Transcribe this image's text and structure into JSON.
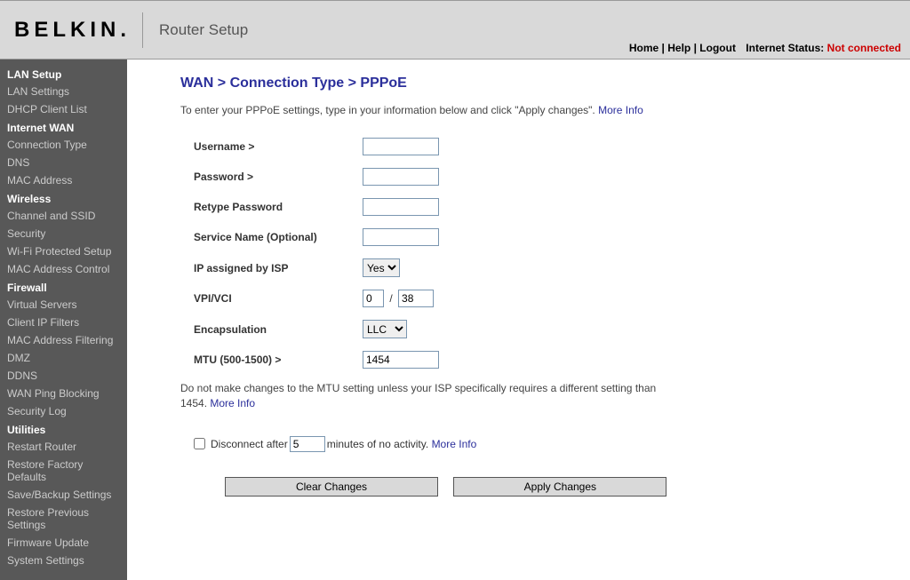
{
  "header": {
    "logo_text": "BELKIN",
    "title": "Router Setup",
    "links": {
      "home": "Home",
      "help": "Help",
      "logout": "Logout"
    },
    "internet_status_label": "Internet Status:",
    "internet_status_value": "Not connected"
  },
  "sidebar": {
    "s1": {
      "head": "LAN Setup",
      "i0": "LAN Settings",
      "i1": "DHCP Client List"
    },
    "s2": {
      "head": "Internet WAN",
      "i0": "Connection Type",
      "i1": "DNS",
      "i2": "MAC Address"
    },
    "s3": {
      "head": "Wireless",
      "i0": "Channel and SSID",
      "i1": "Security",
      "i2": "Wi-Fi Protected Setup",
      "i3": "MAC Address Control"
    },
    "s4": {
      "head": "Firewall",
      "i0": "Virtual Servers",
      "i1": "Client IP Filters",
      "i2": "MAC Address Filtering",
      "i3": "DMZ",
      "i4": "DDNS",
      "i5": "WAN Ping Blocking",
      "i6": "Security Log"
    },
    "s5": {
      "head": "Utilities",
      "i0": "Restart Router",
      "i1": "Restore Factory Defaults",
      "i2": "Save/Backup Settings",
      "i3": "Restore Previous Settings",
      "i4": "Firmware Update",
      "i5": "System Settings"
    }
  },
  "page": {
    "title": "WAN > Connection Type > PPPoE",
    "intro_text": "To enter your PPPoE settings, type in your information below and click \"Apply changes\".",
    "more_info": "More Info",
    "fields": {
      "username_label": "Username >",
      "username_value": "",
      "password_label": "Password >",
      "password_value": "",
      "retype_label": "Retype Password",
      "retype_value": "",
      "service_label": "Service Name (Optional)",
      "service_value": "",
      "ip_assigned_label": "IP assigned by ISP",
      "ip_assigned_value": "Yes",
      "vpi_vci_label": "VPI/VCI",
      "vpi_value": "0",
      "vci_value": "38",
      "vpi_vci_sep": "/",
      "encapsulation_label": "Encapsulation",
      "encapsulation_value": "LLC",
      "mtu_label": "MTU (500-1500) >",
      "mtu_value": "1454"
    },
    "mtu_note": "Do not make changes to the MTU setting unless your ISP specifically requires a different setting than 1454.",
    "disconnect": {
      "label_before": "Disconnect after",
      "minutes_value": "5",
      "label_after": "minutes of no activity."
    },
    "buttons": {
      "clear": "Clear Changes",
      "apply": "Apply Changes"
    }
  }
}
